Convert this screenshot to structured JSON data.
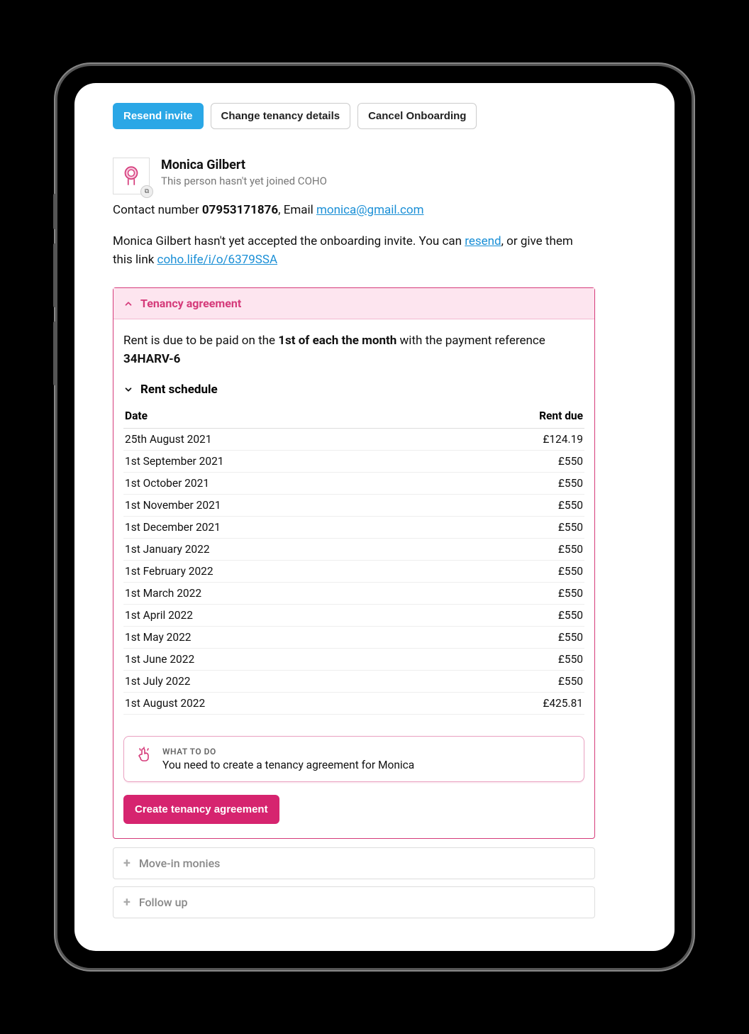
{
  "buttons": {
    "resend": "Resend invite",
    "change_details": "Change tenancy details",
    "cancel": "Cancel Onboarding"
  },
  "person": {
    "name": "Monica Gilbert",
    "joined_status": "This person hasn't yet joined COHO"
  },
  "contact": {
    "prefix": "Contact number ",
    "phone": "07953171876",
    "email_prefix": ", Email ",
    "email": "monica@gmail.com"
  },
  "invite_para": {
    "part1": "Monica Gilbert hasn't yet accepted the onboarding invite. You can ",
    "resend_link": "resend",
    "part2": ", or give them this link ",
    "link": "coho.life/i/o/6379SSA"
  },
  "tenancy": {
    "header": "Tenancy agreement",
    "rent_text_pre": "Rent is due to be paid on the ",
    "rent_text_bold": "1st of each the month",
    "rent_text_mid": " with the payment reference ",
    "rent_ref": "34HARV-6",
    "schedule_label": "Rent schedule",
    "col_date": "Date",
    "col_rent": "Rent due",
    "rows": [
      {
        "date": "25th August 2021",
        "amount": "£124.19"
      },
      {
        "date": "1st September 2021",
        "amount": "£550"
      },
      {
        "date": "1st October 2021",
        "amount": "£550"
      },
      {
        "date": "1st November 2021",
        "amount": "£550"
      },
      {
        "date": "1st December 2021",
        "amount": "£550"
      },
      {
        "date": "1st January 2022",
        "amount": "£550"
      },
      {
        "date": "1st February 2022",
        "amount": "£550"
      },
      {
        "date": "1st March 2022",
        "amount": "£550"
      },
      {
        "date": "1st April 2022",
        "amount": "£550"
      },
      {
        "date": "1st May 2022",
        "amount": "£550"
      },
      {
        "date": "1st June 2022",
        "amount": "£550"
      },
      {
        "date": "1st July 2022",
        "amount": "£550"
      },
      {
        "date": "1st August 2022",
        "amount": "£425.81"
      }
    ],
    "todo_title": "WHAT TO DO",
    "todo_text": "You need to create a tenancy agreement for Monica",
    "create_btn": "Create tenancy agreement"
  },
  "collapsed": {
    "move_in": "Move-in monies",
    "follow_up": "Follow up"
  }
}
